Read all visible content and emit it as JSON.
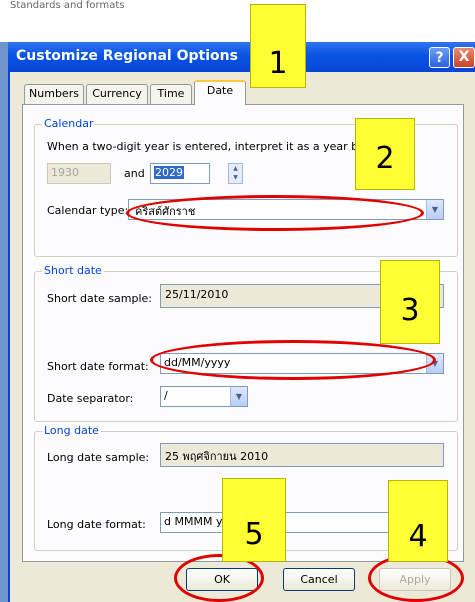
{
  "background": {
    "caption": "Standards and formats"
  },
  "window": {
    "title": "Customize Regional Options",
    "help_glyph": "?",
    "close_glyph": "X"
  },
  "tabs": [
    {
      "label": "Numbers"
    },
    {
      "label": "Currency"
    },
    {
      "label": "Time"
    },
    {
      "label": "Date"
    }
  ],
  "active_tab": "Date",
  "calendar": {
    "legend": "Calendar",
    "instruction": "When a two-digit year is entered, interpret it as a year between:",
    "year_start": "1930",
    "and_label": "and",
    "year_end": "2029",
    "type_label": "Calendar type:",
    "type_value": "คริสต์ศักราช"
  },
  "short_date": {
    "legend": "Short date",
    "sample_label": "Short date sample:",
    "sample_value": "25/11/2010",
    "format_label": "Short date format:",
    "format_value": "dd/MM/yyyy",
    "separator_label": "Date separator:",
    "separator_value": "/"
  },
  "long_date": {
    "legend": "Long date",
    "sample_label": "Long date sample:",
    "sample_value": "25 พฤศจิกายน 2010",
    "format_label": "Long date format:",
    "format_value": "d MMMM yyyy"
  },
  "buttons": {
    "ok": "OK",
    "cancel": "Cancel",
    "apply": "Apply"
  },
  "annotations": {
    "n1": "1",
    "n2": "2",
    "n3": "3",
    "n4": "4",
    "n5": "5"
  },
  "colors": {
    "title_bar": "#0a54e3",
    "legend_text": "#0046d5",
    "annotation_fill": "#ffff33",
    "annotation_ring": "#e00000"
  },
  "icons": {
    "help": "help-icon",
    "close": "close-icon",
    "spin_up": "spin-up-icon",
    "spin_down": "spin-down-icon",
    "dropdown": "chevron-down-icon"
  }
}
